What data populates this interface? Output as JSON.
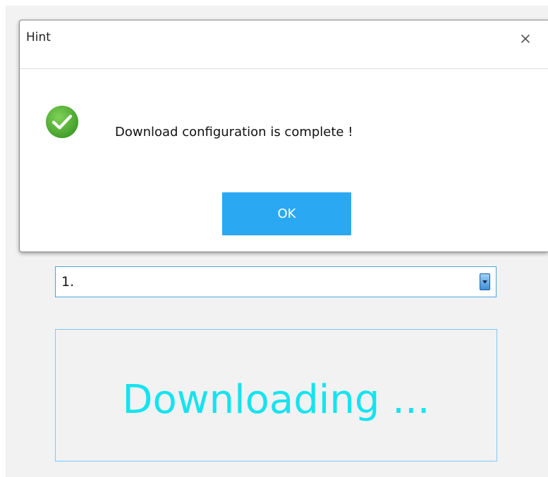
{
  "dialog": {
    "title": "Hint",
    "close_label": "×",
    "message": "Download configuration is complete !",
    "status_icon": "success-check-icon",
    "ok_label": "OK"
  },
  "combo": {
    "selected": "1.",
    "arrow_icon": "chevron-down-icon"
  },
  "status": {
    "text": "Downloading ..."
  },
  "colors": {
    "accent": "#2aa8f2",
    "success": "#52b43a",
    "status_text": "#16e3ef",
    "panel_bg": "#f2f2f2"
  }
}
